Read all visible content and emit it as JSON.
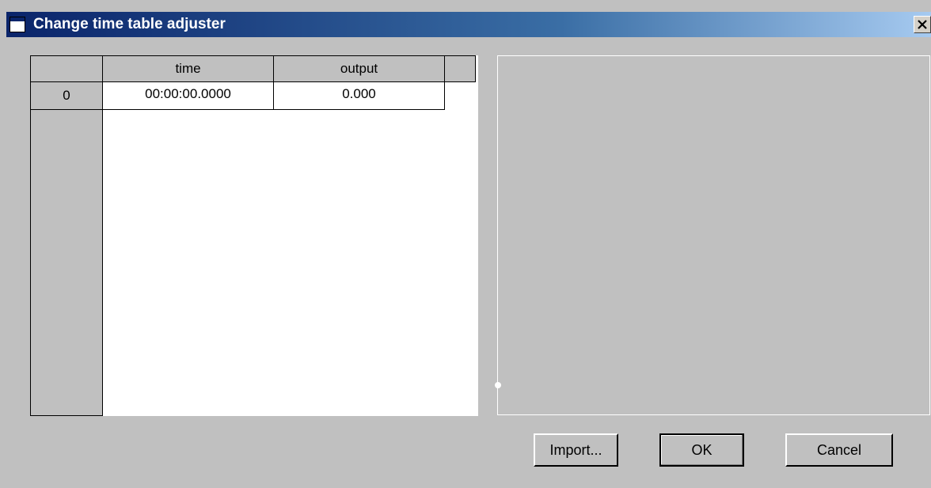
{
  "window": {
    "title": "Change time table adjuster"
  },
  "table": {
    "columns": [
      "time",
      "output"
    ],
    "rows": [
      {
        "index": "0",
        "time": "00:00:00.0000",
        "output": "0.000"
      }
    ]
  },
  "buttons": {
    "import": "Import...",
    "ok": "OK",
    "cancel": "Cancel"
  },
  "icons": {
    "window": "window-icon",
    "close": "close-icon"
  },
  "colors": {
    "titlebar_start": "#0a246a",
    "titlebar_end": "#a6caf0",
    "dialog_bg": "#c0c0c0"
  }
}
